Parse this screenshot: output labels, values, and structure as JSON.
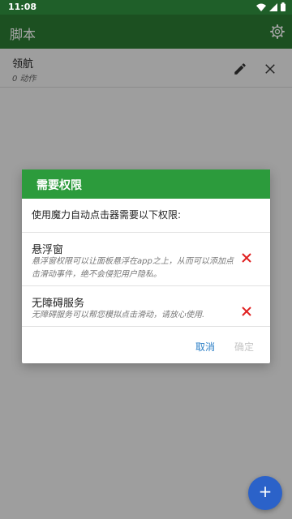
{
  "status_bar": {
    "time": "11:08",
    "icons": [
      "wifi-icon",
      "signal-icon",
      "battery-icon"
    ]
  },
  "app_bar": {
    "title": "脚本",
    "settings_icon": "gear-icon"
  },
  "script_list": [
    {
      "name": "领航",
      "subtitle": "0 动作",
      "edit_icon": "pencil-icon",
      "delete_icon": "close-icon"
    }
  ],
  "dialog": {
    "title": "需要权限",
    "description": "使用魔力自动点击器需要以下权限:",
    "permissions": [
      {
        "title": "悬浮窗",
        "description": "悬浮窗权限可以让面板悬浮在app之上，从而可以添加点击滑动事件，绝不会侵犯用户隐私。",
        "status_icon": "x-icon"
      },
      {
        "title": "无障碍服务",
        "description": "无障碍服务可以帮您模拟点击滑动，请放心使用.",
        "status_icon": "x-icon"
      }
    ],
    "cancel_label": "取消",
    "confirm_label": "确定"
  },
  "fab": {
    "label": "+"
  },
  "colors": {
    "status_bar": "#1f5f29",
    "app_bar": "#2c7b34",
    "dialog_header": "#2c9b3c",
    "accent": "#2a7ec6",
    "fab": "#2b62c9",
    "error": "#e02020"
  }
}
